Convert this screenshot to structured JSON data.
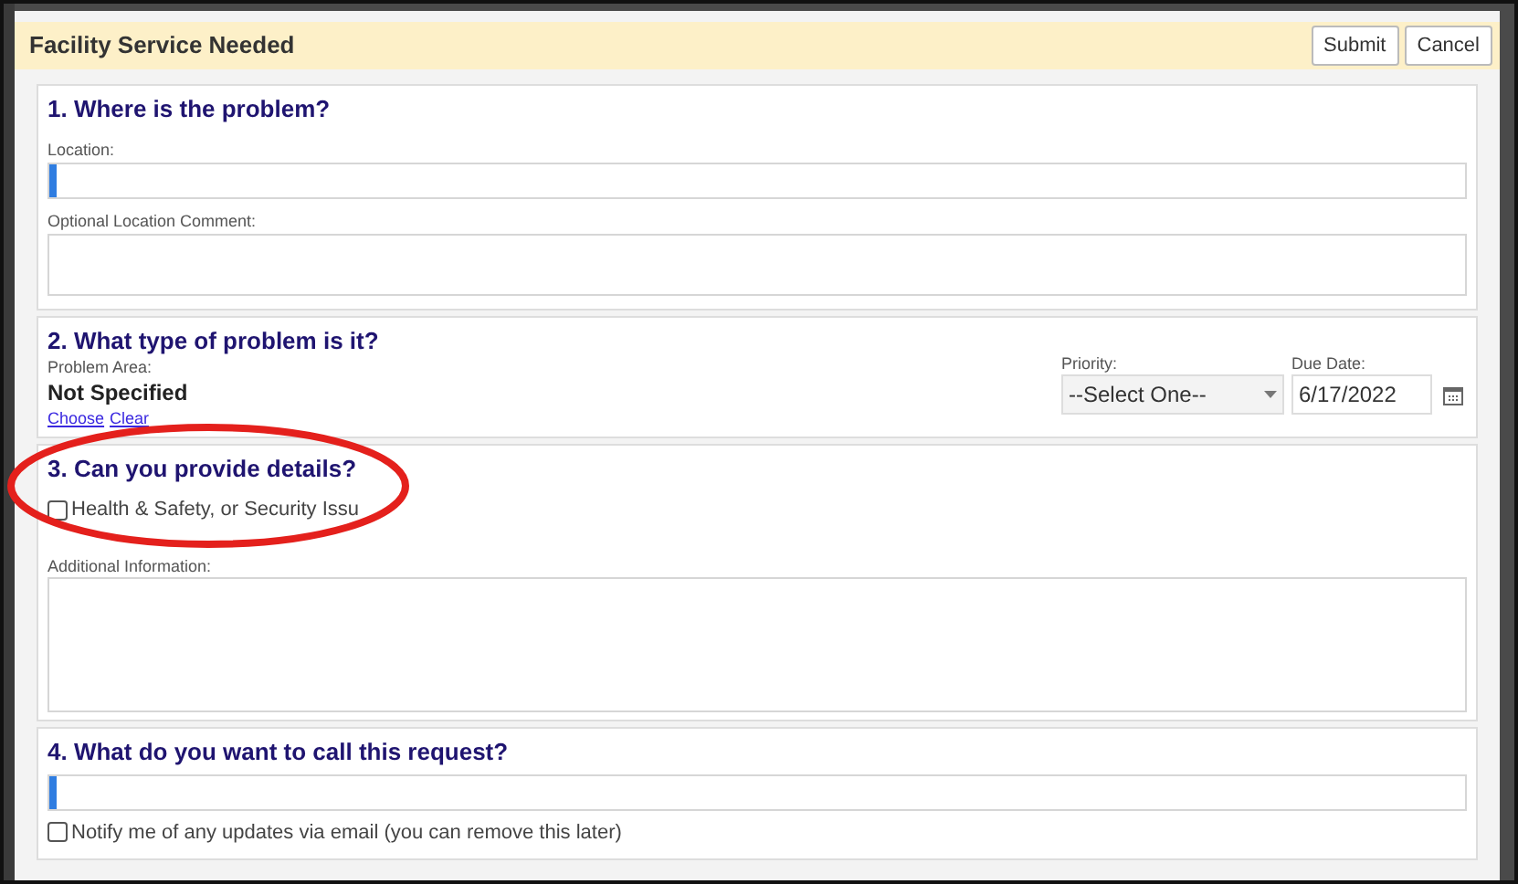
{
  "dialog": {
    "title": "Facility Service Needed",
    "buttons": [
      "Submit",
      "Cancel"
    ]
  },
  "section_1": {
    "heading": "1. Where is the problem?",
    "location": {
      "label": "Location:",
      "focused": true
    },
    "comment": {
      "label": "Optional Location Comment:"
    }
  },
  "section_2": {
    "heading": "2. What type of problem is it?",
    "problem_area": {
      "label": "Problem Area:",
      "value": "Not Specified",
      "links": [
        "Choose",
        "Clear"
      ]
    },
    "priority": {
      "label": "Priority:",
      "value": "--Select One--"
    },
    "due_date": {
      "label": "Due Date:",
      "value": "6/17/2022"
    }
  },
  "section_3": {
    "heading": "3. Can you provide details?",
    "safety": {
      "label": "Health & Safety, or Security Issu",
      "checked": false
    },
    "additional": {
      "label": "Additional Information:"
    }
  },
  "section_4": {
    "heading": "4. What do you want to call this request?",
    "name_field": {
      "focused": true
    },
    "notify": {
      "label": "Notify me of any updates via email (you can remove this later)",
      "checked": false
    }
  }
}
